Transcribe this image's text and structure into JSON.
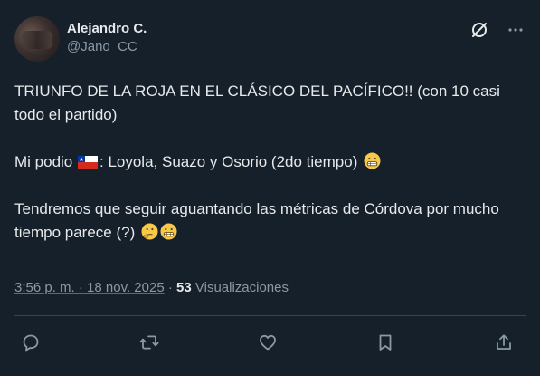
{
  "author": {
    "display_name": "Alejandro C.",
    "handle": "@Jano_CC"
  },
  "icons": {
    "grok": "grok-icon",
    "more": "more-icon"
  },
  "post": {
    "line1": "TRIUNFO DE LA ROJA EN EL CLÁSICO DEL PACÍFICO!! (con 10 casi todo el partido)",
    "line2_prefix": "Mi podio",
    "line2_suffix": ": Loyola, Suazo y Osorio (2do tiempo)",
    "line3": "Tendremos que seguir aguantando las métricas de Córdova por mucho tiempo parece (?)"
  },
  "meta": {
    "timestamp": "3:56 p. m. · 18 nov. 2025",
    "separator": "·",
    "views_count": "53",
    "views_label": "Visualizaciones"
  },
  "actions": [
    "reply-icon",
    "repost-icon",
    "like-icon",
    "bookmark-icon",
    "share-icon"
  ],
  "colors": {
    "background": "#15202b",
    "text": "#e7e9ea",
    "secondary": "#8b98a5",
    "divider": "#38444d"
  }
}
